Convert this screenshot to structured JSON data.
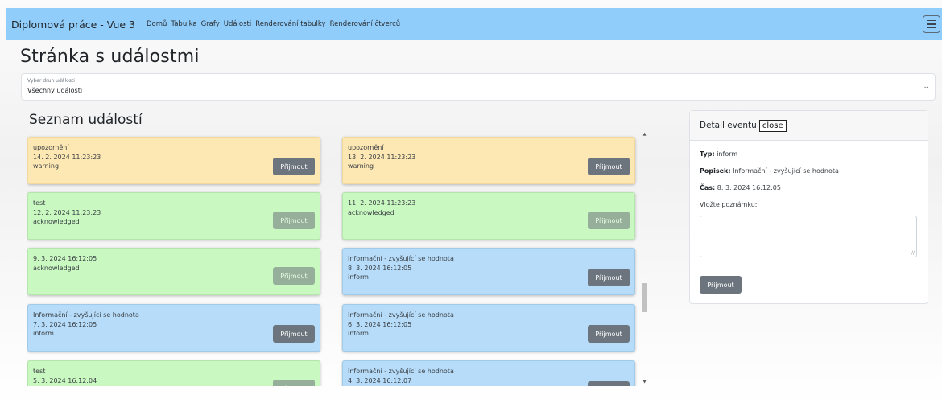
{
  "navbar": {
    "brand": "Diplomová práce - Vue 3",
    "links": [
      "Domů",
      "Tabulka",
      "Grafy",
      "Události",
      "Renderování tabulky",
      "Renderování čtverců"
    ]
  },
  "page": {
    "title": "Stránka s událostmi"
  },
  "filter": {
    "label": "Vyber druh události",
    "value": "Všechny události"
  },
  "list": {
    "title": "Seznam událostí",
    "events": [
      {
        "lines": [
          "upozornění",
          "14. 2. 2024 11:23:23",
          "warning"
        ],
        "status": "warning",
        "button": "Přijmout",
        "button_disabled": false
      },
      {
        "lines": [
          "upozornění",
          "13. 2. 2024 11:23:23",
          "warning"
        ],
        "status": "warning",
        "button": "Přijmout",
        "button_disabled": false
      },
      {
        "lines": [
          "test",
          "12. 2. 2024 11:23:23",
          "acknowledged"
        ],
        "status": "acknowledged",
        "button": "Přijmout",
        "button_disabled": true
      },
      {
        "lines": [
          "11. 2. 2024 11:23:23",
          "acknowledged"
        ],
        "status": "acknowledged",
        "button": "Přijmout",
        "button_disabled": true
      },
      {
        "lines": [
          "9. 3. 2024 16:12:05",
          "acknowledged"
        ],
        "status": "acknowledged",
        "button": "Přijmout",
        "button_disabled": true
      },
      {
        "lines": [
          "Informační - zvyšující se hodnota",
          "8. 3. 2024 16:12:05",
          "inform"
        ],
        "status": "inform",
        "button": "Přijmout",
        "button_disabled": false
      },
      {
        "lines": [
          "Informační - zvyšující se hodnota",
          "7. 3. 2024 16:12:05",
          "inform"
        ],
        "status": "inform",
        "button": "Přijmout",
        "button_disabled": false
      },
      {
        "lines": [
          "Informační - zvyšující se hodnota",
          "6. 3. 2024 16:12:05",
          "inform"
        ],
        "status": "inform",
        "button": "Přijmout",
        "button_disabled": false
      },
      {
        "lines": [
          "test",
          "5. 3. 2024 16:12:04"
        ],
        "status": "acknowledged",
        "button": "Přijmout",
        "button_disabled": true
      },
      {
        "lines": [
          "Informační - zvyšující se hodnota",
          "4. 3. 2024 16:12:07"
        ],
        "status": "inform",
        "button": "Přijmout",
        "button_disabled": false
      }
    ]
  },
  "detail": {
    "header": "Detail eventu",
    "close_label": "close",
    "type_label": "Typ:",
    "type_value": "inform",
    "desc_label": "Popisek:",
    "desc_value": "Informační - zvyšující se hodnota",
    "time_label": "Čas:",
    "time_value": "8. 3. 2024 16:12:05",
    "note_label": "Vložte poznámku:",
    "submit_label": "Přijmout"
  },
  "colors": {
    "navbar": "#91cdfa",
    "warning": "#fde8b3",
    "acknowledged": "#c9f8c1",
    "inform": "#b6dcf9",
    "button": "#6c757d"
  }
}
